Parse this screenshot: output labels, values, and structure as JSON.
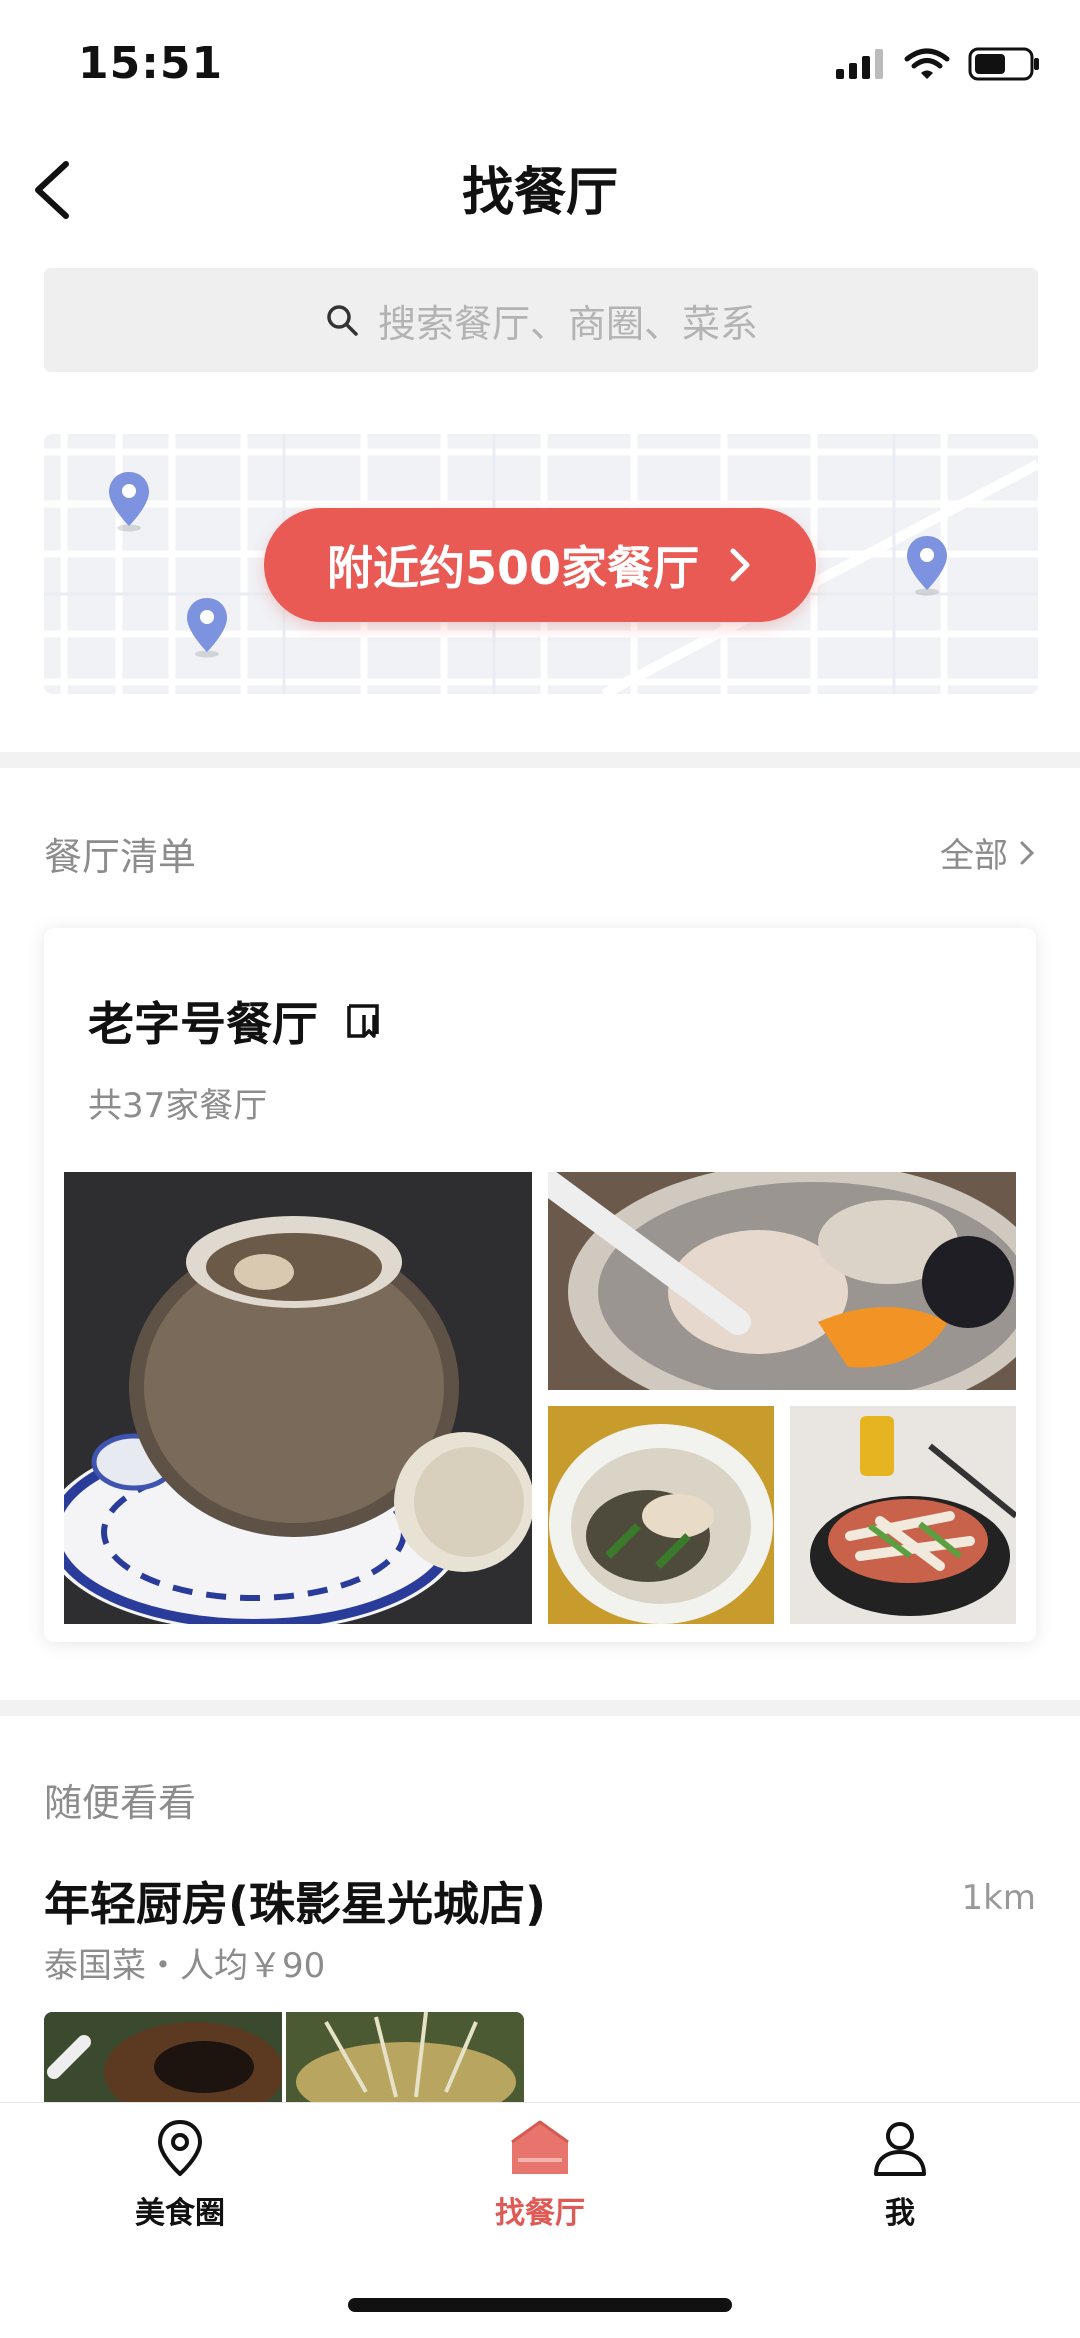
{
  "status_bar": {
    "time": "15:51"
  },
  "header": {
    "title": "找餐厅"
  },
  "search": {
    "placeholder": "搜索餐厅、商圈、菜系"
  },
  "map": {
    "nearby_label": "附近约500家餐厅"
  },
  "list_section": {
    "title": "餐厅清单",
    "all_label": "全部",
    "card": {
      "title": "老字号餐厅",
      "count_text": "共37家餐厅"
    }
  },
  "browse_section": {
    "title": "随便看看",
    "restaurant": {
      "name": "年轻厨房(珠影星光城店)",
      "distance": "1km",
      "meta": "泰国菜・人均￥90"
    }
  },
  "tabbar": {
    "items": [
      {
        "label": "美食圈",
        "icon": "location-pin-icon"
      },
      {
        "label": "找餐厅",
        "icon": "house-icon",
        "active": true
      },
      {
        "label": "我",
        "icon": "person-icon"
      }
    ],
    "active_color": "#e05a55"
  },
  "colors": {
    "accent": "#ea5a55",
    "map_pin": "#7d93e0"
  }
}
